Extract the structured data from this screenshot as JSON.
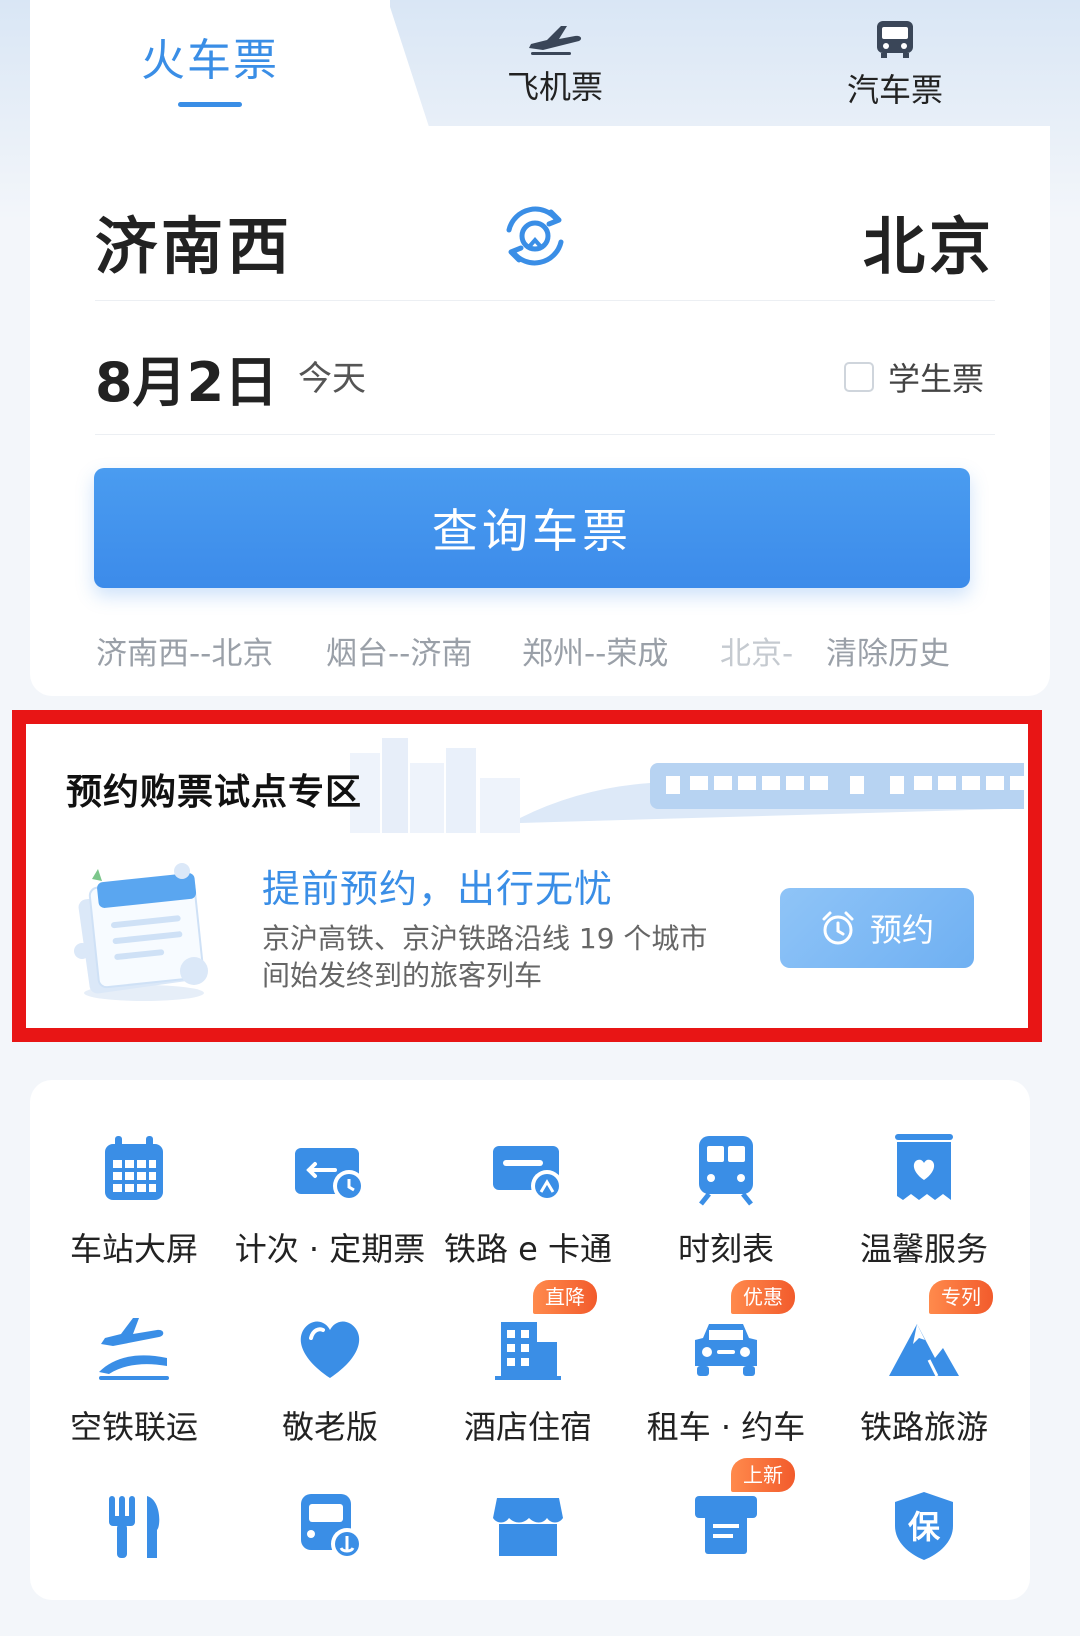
{
  "tabs": [
    {
      "label": "火车票",
      "active": true,
      "icon": "train"
    },
    {
      "label": "飞机票",
      "active": false,
      "icon": "plane-icon"
    },
    {
      "label": "汽车票",
      "active": false,
      "icon": "bus-icon"
    }
  ],
  "route": {
    "from": "济南西",
    "to": "北京"
  },
  "date": {
    "value": "8月2日",
    "relative": "今天"
  },
  "student_ticket": {
    "label": "学生票",
    "checked": false
  },
  "search_button": "查询车票",
  "history": [
    "济南西--北京",
    "烟台--济南",
    "郑州--荣成",
    "北京-"
  ],
  "clear_history": "清除历史",
  "promo": {
    "title": "预约购票试点专区",
    "subtitle": "提前预约，出行无忧",
    "desc_line1": "京沪高铁、京沪铁路沿线 19 个城市",
    "desc_line2": "间始发终到的旅客列车",
    "button": "预约"
  },
  "services": [
    {
      "label": "车站大屏",
      "icon": "calendar-grid-icon"
    },
    {
      "label": "计次 · 定期票",
      "icon": "ticket-clock-icon"
    },
    {
      "label": "铁路 e 卡通",
      "icon": "card-icon"
    },
    {
      "label": "时刻表",
      "icon": "train-front-icon"
    },
    {
      "label": "温馨服务",
      "icon": "heart-box-icon"
    },
    {
      "label": "空铁联运",
      "icon": "plane-train-icon"
    },
    {
      "label": "敬老版",
      "icon": "heart-icon"
    },
    {
      "label": "酒店住宿",
      "icon": "hotel-icon",
      "badge": "直降"
    },
    {
      "label": "租车 · 约车",
      "icon": "car-icon",
      "badge": "优惠"
    },
    {
      "label": "铁路旅游",
      "icon": "mountain-icon",
      "badge": "专列"
    },
    {
      "label": "",
      "icon": "fork-knife-icon"
    },
    {
      "label": "",
      "icon": "bus-anchor-icon"
    },
    {
      "label": "",
      "icon": "shop-icon"
    },
    {
      "label": "",
      "icon": "printer-icon",
      "badge": "上新"
    },
    {
      "label": "",
      "icon": "insurance-shield-icon",
      "glyph": "保"
    }
  ],
  "colors": {
    "primary": "#3a8ee6",
    "highlight": "#e81515",
    "badge": "#f25b2c"
  }
}
